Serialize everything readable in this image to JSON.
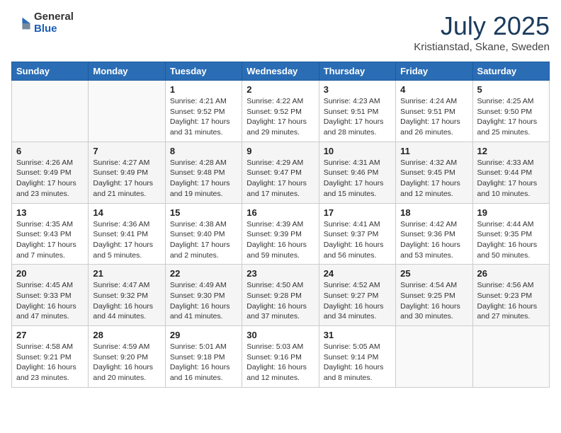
{
  "header": {
    "logo_general": "General",
    "logo_blue": "Blue",
    "month_title": "July 2025",
    "location": "Kristianstad, Skane, Sweden"
  },
  "weekdays": [
    "Sunday",
    "Monday",
    "Tuesday",
    "Wednesday",
    "Thursday",
    "Friday",
    "Saturday"
  ],
  "weeks": [
    [
      {
        "day": "",
        "detail": ""
      },
      {
        "day": "",
        "detail": ""
      },
      {
        "day": "1",
        "detail": "Sunrise: 4:21 AM\nSunset: 9:52 PM\nDaylight: 17 hours and 31 minutes."
      },
      {
        "day": "2",
        "detail": "Sunrise: 4:22 AM\nSunset: 9:52 PM\nDaylight: 17 hours and 29 minutes."
      },
      {
        "day": "3",
        "detail": "Sunrise: 4:23 AM\nSunset: 9:51 PM\nDaylight: 17 hours and 28 minutes."
      },
      {
        "day": "4",
        "detail": "Sunrise: 4:24 AM\nSunset: 9:51 PM\nDaylight: 17 hours and 26 minutes."
      },
      {
        "day": "5",
        "detail": "Sunrise: 4:25 AM\nSunset: 9:50 PM\nDaylight: 17 hours and 25 minutes."
      }
    ],
    [
      {
        "day": "6",
        "detail": "Sunrise: 4:26 AM\nSunset: 9:49 PM\nDaylight: 17 hours and 23 minutes."
      },
      {
        "day": "7",
        "detail": "Sunrise: 4:27 AM\nSunset: 9:49 PM\nDaylight: 17 hours and 21 minutes."
      },
      {
        "day": "8",
        "detail": "Sunrise: 4:28 AM\nSunset: 9:48 PM\nDaylight: 17 hours and 19 minutes."
      },
      {
        "day": "9",
        "detail": "Sunrise: 4:29 AM\nSunset: 9:47 PM\nDaylight: 17 hours and 17 minutes."
      },
      {
        "day": "10",
        "detail": "Sunrise: 4:31 AM\nSunset: 9:46 PM\nDaylight: 17 hours and 15 minutes."
      },
      {
        "day": "11",
        "detail": "Sunrise: 4:32 AM\nSunset: 9:45 PM\nDaylight: 17 hours and 12 minutes."
      },
      {
        "day": "12",
        "detail": "Sunrise: 4:33 AM\nSunset: 9:44 PM\nDaylight: 17 hours and 10 minutes."
      }
    ],
    [
      {
        "day": "13",
        "detail": "Sunrise: 4:35 AM\nSunset: 9:43 PM\nDaylight: 17 hours and 7 minutes."
      },
      {
        "day": "14",
        "detail": "Sunrise: 4:36 AM\nSunset: 9:41 PM\nDaylight: 17 hours and 5 minutes."
      },
      {
        "day": "15",
        "detail": "Sunrise: 4:38 AM\nSunset: 9:40 PM\nDaylight: 17 hours and 2 minutes."
      },
      {
        "day": "16",
        "detail": "Sunrise: 4:39 AM\nSunset: 9:39 PM\nDaylight: 16 hours and 59 minutes."
      },
      {
        "day": "17",
        "detail": "Sunrise: 4:41 AM\nSunset: 9:37 PM\nDaylight: 16 hours and 56 minutes."
      },
      {
        "day": "18",
        "detail": "Sunrise: 4:42 AM\nSunset: 9:36 PM\nDaylight: 16 hours and 53 minutes."
      },
      {
        "day": "19",
        "detail": "Sunrise: 4:44 AM\nSunset: 9:35 PM\nDaylight: 16 hours and 50 minutes."
      }
    ],
    [
      {
        "day": "20",
        "detail": "Sunrise: 4:45 AM\nSunset: 9:33 PM\nDaylight: 16 hours and 47 minutes."
      },
      {
        "day": "21",
        "detail": "Sunrise: 4:47 AM\nSunset: 9:32 PM\nDaylight: 16 hours and 44 minutes."
      },
      {
        "day": "22",
        "detail": "Sunrise: 4:49 AM\nSunset: 9:30 PM\nDaylight: 16 hours and 41 minutes."
      },
      {
        "day": "23",
        "detail": "Sunrise: 4:50 AM\nSunset: 9:28 PM\nDaylight: 16 hours and 37 minutes."
      },
      {
        "day": "24",
        "detail": "Sunrise: 4:52 AM\nSunset: 9:27 PM\nDaylight: 16 hours and 34 minutes."
      },
      {
        "day": "25",
        "detail": "Sunrise: 4:54 AM\nSunset: 9:25 PM\nDaylight: 16 hours and 30 minutes."
      },
      {
        "day": "26",
        "detail": "Sunrise: 4:56 AM\nSunset: 9:23 PM\nDaylight: 16 hours and 27 minutes."
      }
    ],
    [
      {
        "day": "27",
        "detail": "Sunrise: 4:58 AM\nSunset: 9:21 PM\nDaylight: 16 hours and 23 minutes."
      },
      {
        "day": "28",
        "detail": "Sunrise: 4:59 AM\nSunset: 9:20 PM\nDaylight: 16 hours and 20 minutes."
      },
      {
        "day": "29",
        "detail": "Sunrise: 5:01 AM\nSunset: 9:18 PM\nDaylight: 16 hours and 16 minutes."
      },
      {
        "day": "30",
        "detail": "Sunrise: 5:03 AM\nSunset: 9:16 PM\nDaylight: 16 hours and 12 minutes."
      },
      {
        "day": "31",
        "detail": "Sunrise: 5:05 AM\nSunset: 9:14 PM\nDaylight: 16 hours and 8 minutes."
      },
      {
        "day": "",
        "detail": ""
      },
      {
        "day": "",
        "detail": ""
      }
    ]
  ]
}
